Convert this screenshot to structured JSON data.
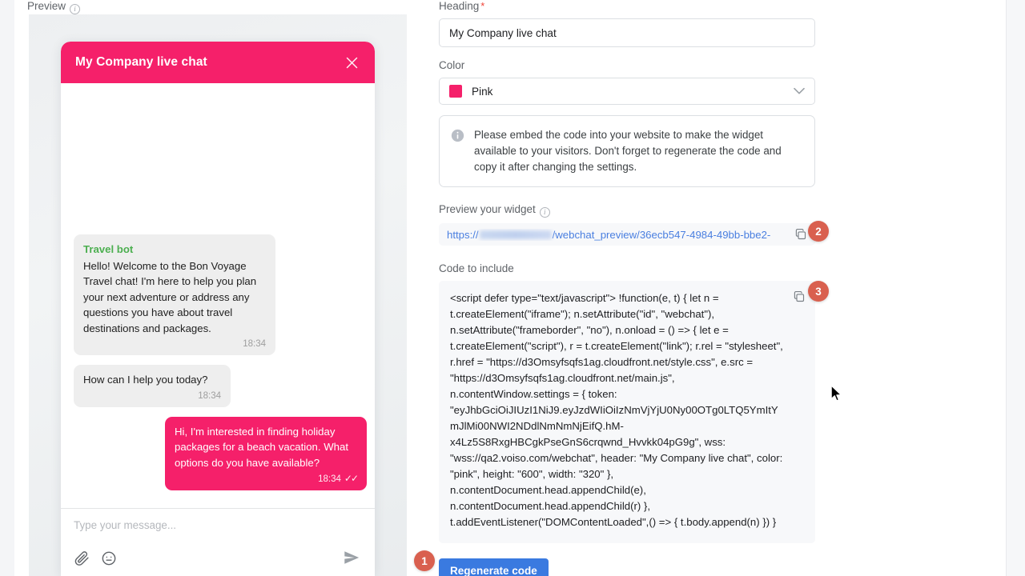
{
  "brand_color": "#f5206a",
  "badge_color": "#d9604f",
  "preview": {
    "label": "Preview",
    "info_icon": "info-icon"
  },
  "widget": {
    "title": "My Company live chat",
    "close_icon": "close-icon",
    "messages": [
      {
        "role": "bot",
        "sender": "Travel bot",
        "text": "Hello! Welcome to the Bon Voyage Travel chat! I'm here to help you plan your next adventure or address any questions you have about travel destinations and packages.",
        "time": "18:34"
      },
      {
        "role": "bot",
        "sender": "",
        "text": "How can I help you today?",
        "time": "18:34"
      },
      {
        "role": "user",
        "sender": "",
        "text": "Hi, I'm interested in finding holiday packages for a beach vacation. What options do you have available?",
        "time": "18:34",
        "ticks": "✓✓"
      }
    ],
    "compose": {
      "placeholder": "Type your message...",
      "attach_icon": "paperclip-icon",
      "emoji_icon": "emoji-icon",
      "send_icon": "send-icon"
    }
  },
  "form": {
    "heading": {
      "label": "Heading",
      "required_marker": "*",
      "value": "My Company live chat"
    },
    "color": {
      "label": "Color",
      "value": "Pink",
      "chevron_icon": "chevron-down-icon"
    },
    "notice": {
      "icon": "info-icon",
      "text": "Please embed the code into your website to make the widget available to your visitors. Don't forget to regenerate the code and copy it after changing the settings."
    },
    "preview_widget": {
      "label": "Preview your widget",
      "info_icon": "info-icon",
      "url_prefix": "https://",
      "url_suffix": "/webchat_preview/36ecb547-4984-49bb-bbe2-",
      "copy_icon": "copy-icon"
    },
    "code": {
      "label": "Code to include",
      "copy_icon": "copy-icon",
      "content": "<script defer type=\"text/javascript\"> !function(e, t) { let n = t.createElement(\"iframe\"); n.setAttribute(\"id\", \"webchat\"), n.setAttribute(\"frameborder\", \"no\"), n.onload = () => { let e = t.createElement(\"script\"), r = t.createElement(\"link\"); r.rel = \"stylesheet\", r.href = \"https://d3Omsyfsqfs1ag.cloudfront.net/style.css\", e.src = \"https://d3Omsyfsqfs1ag.cloudfront.net/main.js\", n.contentWindow.settings = { token: \"eyJhbGciOiJIUzI1NiJ9.eyJzdWIiOiIzNmVjYjU0Ny00OTg0LTQ5YmItYmJlMi00NWI2NDdlNmNmNjEifQ.hM-x4Lz5S8RxgHBCgkPseGnS6crqwnd_Hvvkk04pG9g\", wss: \"wss://qa2.voiso.com/webchat\", header: \"My Company live chat\", color: \"pink\", height: \"600\", width: \"320\" }, n.contentDocument.head.appendChild(e), n.contentDocument.head.appendChild(r) }, t.addEventListener(\"DOMContentLoaded\",() => { t.body.append(n) }) }"
    },
    "regenerate_button": "Regenerate code"
  },
  "badges": {
    "one": "1",
    "two": "2",
    "three": "3"
  }
}
